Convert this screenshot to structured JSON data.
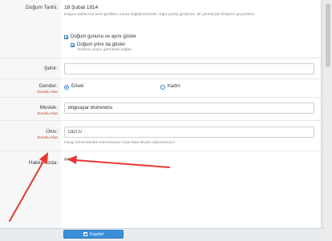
{
  "form": {
    "birth_date": {
      "label": "Doğum Tarihi:",
      "value": "18 Şubat 1914",
      "help": "Doğum tarihini bir kere girdikten sonra değiştiremezsin. Eğer yanlış girdiysen, bir yöneticiyle iletişime geçmelisin.",
      "show_birthday": "Doğum gununu ve ayını göster",
      "show_year": "Doğum yılını da göster",
      "show_year_help": "Verilerin yaşını görmesini sağlar."
    },
    "city": {
      "label": "Şehir:",
      "value": ""
    },
    "gender": {
      "label": "Gender:",
      "required": "Zorunlu Alan",
      "options": [
        "Erkek",
        "Kadın"
      ],
      "selected": "Erkek"
    },
    "job": {
      "label": "Meslek:",
      "required": "Zorunlu Alan",
      "value": "Bilgisayar Muhendisi"
    },
    "university": {
      "label": "Üniv:",
      "required": "Zorunlu Alan",
      "value": "ODTU",
      "help": "Hangi üniversiteden mezunsunuz veya hala devam ediyorsunuz?"
    },
    "about": {
      "label": "Hakkımızda:",
      "value": "####"
    }
  },
  "footer": {
    "save_label": "Kaydet"
  },
  "colors": {
    "accent": "#3b8fd9",
    "required": "#c0392b",
    "arrow": "#e53935"
  }
}
